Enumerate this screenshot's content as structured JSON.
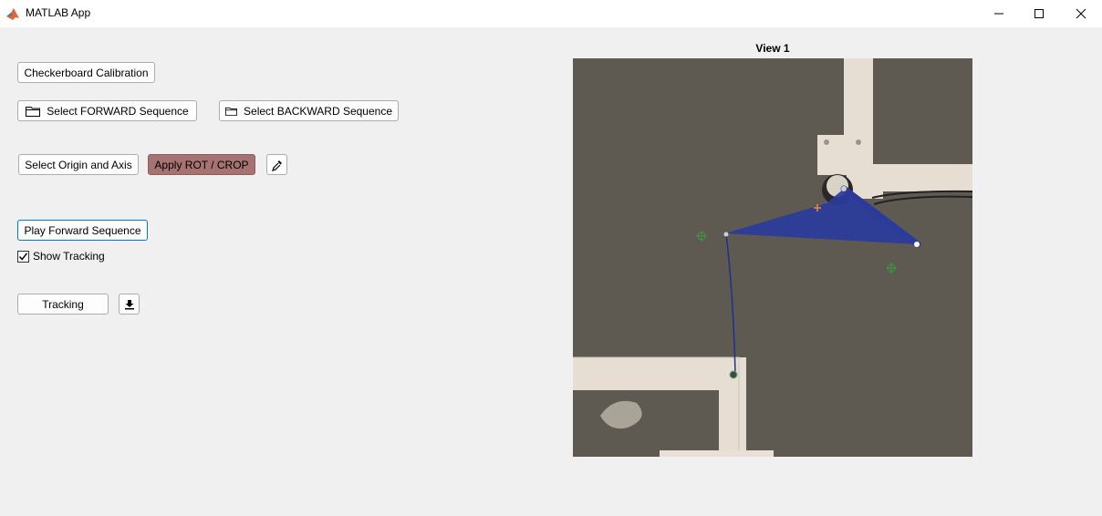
{
  "window": {
    "title": "MATLAB App"
  },
  "controls": {
    "calibration_label": "Checkerboard Calibration",
    "forward_seq_label": "Select FORWARD Sequence",
    "backward_seq_label": "Select BACKWARD Sequence",
    "origin_axis_label": "Select Origin and Axis",
    "apply_rot_crop_label": "Apply ROT / CROP",
    "play_forward_label": "Play Forward Sequence",
    "show_tracking_label": "Show Tracking",
    "show_tracking_checked": true,
    "tracking_label": "Tracking"
  },
  "view": {
    "title": "View 1"
  },
  "colors": {
    "apply_button": "#a77272",
    "tracking_overlay": "#2a3b9c",
    "background_plate": "#5e5a52"
  }
}
